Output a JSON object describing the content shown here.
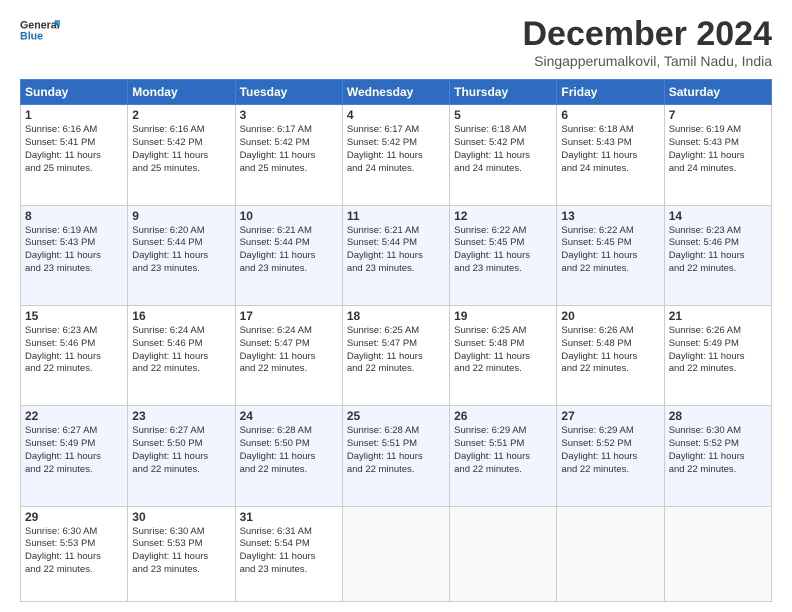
{
  "logo": {
    "general": "General",
    "blue": "Blue"
  },
  "header": {
    "month": "December 2024",
    "location": "Singapperumalkovil, Tamil Nadu, India"
  },
  "weekdays": [
    "Sunday",
    "Monday",
    "Tuesday",
    "Wednesday",
    "Thursday",
    "Friday",
    "Saturday"
  ],
  "weeks": [
    [
      {
        "day": "1",
        "text": "Sunrise: 6:16 AM\nSunset: 5:41 PM\nDaylight: 11 hours\nand 25 minutes."
      },
      {
        "day": "2",
        "text": "Sunrise: 6:16 AM\nSunset: 5:42 PM\nDaylight: 11 hours\nand 25 minutes."
      },
      {
        "day": "3",
        "text": "Sunrise: 6:17 AM\nSunset: 5:42 PM\nDaylight: 11 hours\nand 25 minutes."
      },
      {
        "day": "4",
        "text": "Sunrise: 6:17 AM\nSunset: 5:42 PM\nDaylight: 11 hours\nand 24 minutes."
      },
      {
        "day": "5",
        "text": "Sunrise: 6:18 AM\nSunset: 5:42 PM\nDaylight: 11 hours\nand 24 minutes."
      },
      {
        "day": "6",
        "text": "Sunrise: 6:18 AM\nSunset: 5:43 PM\nDaylight: 11 hours\nand 24 minutes."
      },
      {
        "day": "7",
        "text": "Sunrise: 6:19 AM\nSunset: 5:43 PM\nDaylight: 11 hours\nand 24 minutes."
      }
    ],
    [
      {
        "day": "8",
        "text": "Sunrise: 6:19 AM\nSunset: 5:43 PM\nDaylight: 11 hours\nand 23 minutes."
      },
      {
        "day": "9",
        "text": "Sunrise: 6:20 AM\nSunset: 5:44 PM\nDaylight: 11 hours\nand 23 minutes."
      },
      {
        "day": "10",
        "text": "Sunrise: 6:21 AM\nSunset: 5:44 PM\nDaylight: 11 hours\nand 23 minutes."
      },
      {
        "day": "11",
        "text": "Sunrise: 6:21 AM\nSunset: 5:44 PM\nDaylight: 11 hours\nand 23 minutes."
      },
      {
        "day": "12",
        "text": "Sunrise: 6:22 AM\nSunset: 5:45 PM\nDaylight: 11 hours\nand 23 minutes."
      },
      {
        "day": "13",
        "text": "Sunrise: 6:22 AM\nSunset: 5:45 PM\nDaylight: 11 hours\nand 22 minutes."
      },
      {
        "day": "14",
        "text": "Sunrise: 6:23 AM\nSunset: 5:46 PM\nDaylight: 11 hours\nand 22 minutes."
      }
    ],
    [
      {
        "day": "15",
        "text": "Sunrise: 6:23 AM\nSunset: 5:46 PM\nDaylight: 11 hours\nand 22 minutes."
      },
      {
        "day": "16",
        "text": "Sunrise: 6:24 AM\nSunset: 5:46 PM\nDaylight: 11 hours\nand 22 minutes."
      },
      {
        "day": "17",
        "text": "Sunrise: 6:24 AM\nSunset: 5:47 PM\nDaylight: 11 hours\nand 22 minutes."
      },
      {
        "day": "18",
        "text": "Sunrise: 6:25 AM\nSunset: 5:47 PM\nDaylight: 11 hours\nand 22 minutes."
      },
      {
        "day": "19",
        "text": "Sunrise: 6:25 AM\nSunset: 5:48 PM\nDaylight: 11 hours\nand 22 minutes."
      },
      {
        "day": "20",
        "text": "Sunrise: 6:26 AM\nSunset: 5:48 PM\nDaylight: 11 hours\nand 22 minutes."
      },
      {
        "day": "21",
        "text": "Sunrise: 6:26 AM\nSunset: 5:49 PM\nDaylight: 11 hours\nand 22 minutes."
      }
    ],
    [
      {
        "day": "22",
        "text": "Sunrise: 6:27 AM\nSunset: 5:49 PM\nDaylight: 11 hours\nand 22 minutes."
      },
      {
        "day": "23",
        "text": "Sunrise: 6:27 AM\nSunset: 5:50 PM\nDaylight: 11 hours\nand 22 minutes."
      },
      {
        "day": "24",
        "text": "Sunrise: 6:28 AM\nSunset: 5:50 PM\nDaylight: 11 hours\nand 22 minutes."
      },
      {
        "day": "25",
        "text": "Sunrise: 6:28 AM\nSunset: 5:51 PM\nDaylight: 11 hours\nand 22 minutes."
      },
      {
        "day": "26",
        "text": "Sunrise: 6:29 AM\nSunset: 5:51 PM\nDaylight: 11 hours\nand 22 minutes."
      },
      {
        "day": "27",
        "text": "Sunrise: 6:29 AM\nSunset: 5:52 PM\nDaylight: 11 hours\nand 22 minutes."
      },
      {
        "day": "28",
        "text": "Sunrise: 6:30 AM\nSunset: 5:52 PM\nDaylight: 11 hours\nand 22 minutes."
      }
    ],
    [
      {
        "day": "29",
        "text": "Sunrise: 6:30 AM\nSunset: 5:53 PM\nDaylight: 11 hours\nand 22 minutes."
      },
      {
        "day": "30",
        "text": "Sunrise: 6:30 AM\nSunset: 5:53 PM\nDaylight: 11 hours\nand 23 minutes."
      },
      {
        "day": "31",
        "text": "Sunrise: 6:31 AM\nSunset: 5:54 PM\nDaylight: 11 hours\nand 23 minutes."
      },
      {
        "day": "",
        "text": ""
      },
      {
        "day": "",
        "text": ""
      },
      {
        "day": "",
        "text": ""
      },
      {
        "day": "",
        "text": ""
      }
    ]
  ]
}
